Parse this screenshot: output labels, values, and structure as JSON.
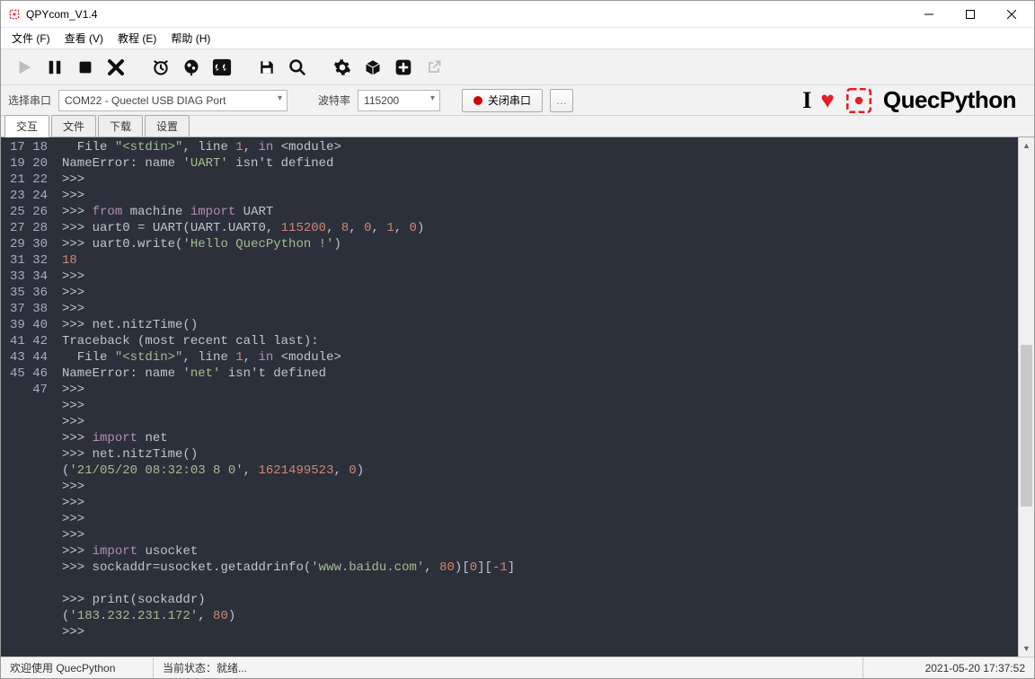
{
  "window": {
    "title": "QPYcom_V1.4"
  },
  "menu": {
    "file": "文件 (F)",
    "view": "查看 (V)",
    "tutorial": "教程 (E)",
    "help": "帮助 (H)"
  },
  "conn": {
    "port_label": "选择串口",
    "port_value": "COM22 - Quectel USB DIAG Port",
    "baud_label": "波特率",
    "baud_value": "115200",
    "close_btn": "关闭串口",
    "more_btn": "…"
  },
  "brand": {
    "i": "I",
    "name": "QuecPython"
  },
  "tabs": {
    "interact": "交互",
    "file": "文件",
    "download": "下载",
    "settings": "设置"
  },
  "editor": {
    "first_line_no": 17,
    "lines": [
      {
        "html": "  File <span class='c-str'>\"&lt;stdin&gt;\"</span>, line <span class='c-num'>1</span>, <span class='c-kw'>in</span> &lt;module&gt;"
      },
      {
        "html": "NameError: name <span class='c-str'>'UART'</span> isn't defined"
      },
      {
        "html": "<span class='c-pr'>&gt;&gt;&gt;</span>"
      },
      {
        "html": "<span class='c-pr'>&gt;&gt;&gt;</span>"
      },
      {
        "html": "<span class='c-pr'>&gt;&gt;&gt;</span> <span class='c-kw'>from</span> machine <span class='c-kw'>import</span> UART"
      },
      {
        "html": "<span class='c-pr'>&gt;&gt;&gt;</span> uart0 = UART(UART.UART0, <span class='c-num'>115200</span>, <span class='c-num'>8</span>, <span class='c-num'>0</span>, <span class='c-num'>1</span>, <span class='c-num'>0</span>)"
      },
      {
        "html": "<span class='c-pr'>&gt;&gt;&gt;</span> uart0.write(<span class='c-str'>'Hello QuecPython !'</span>)"
      },
      {
        "html": "<span class='c-num'>18</span>"
      },
      {
        "html": "<span class='c-pr'>&gt;&gt;&gt;</span>"
      },
      {
        "html": "<span class='c-pr'>&gt;&gt;&gt;</span>"
      },
      {
        "html": "<span class='c-pr'>&gt;&gt;&gt;</span>"
      },
      {
        "html": "<span class='c-pr'>&gt;&gt;&gt;</span> net.nitzTime()"
      },
      {
        "html": "Traceback (most recent call last):"
      },
      {
        "html": "  File <span class='c-str'>\"&lt;stdin&gt;\"</span>, line <span class='c-num'>1</span>, <span class='c-kw'>in</span> &lt;module&gt;"
      },
      {
        "html": "NameError: name <span class='c-str'>'net'</span> isn't defined"
      },
      {
        "html": "<span class='c-pr'>&gt;&gt;&gt;</span>"
      },
      {
        "html": "<span class='c-pr'>&gt;&gt;&gt;</span>"
      },
      {
        "html": "<span class='c-pr'>&gt;&gt;&gt;</span>"
      },
      {
        "html": "<span class='c-pr'>&gt;&gt;&gt;</span> <span class='c-kw'>import</span> net"
      },
      {
        "html": "<span class='c-pr'>&gt;&gt;&gt;</span> net.nitzTime()"
      },
      {
        "html": "(<span class='c-str'>'21/05/20 08:32:03 8 0'</span>, <span class='c-num'>1621499523</span>, <span class='c-num'>0</span>)"
      },
      {
        "html": "<span class='c-pr'>&gt;&gt;&gt;</span>"
      },
      {
        "html": "<span class='c-pr'>&gt;&gt;&gt;</span>"
      },
      {
        "html": "<span class='c-pr'>&gt;&gt;&gt;</span>"
      },
      {
        "html": "<span class='c-pr'>&gt;&gt;&gt;</span>"
      },
      {
        "html": "<span class='c-pr'>&gt;&gt;&gt;</span> <span class='c-kw'>import</span> usocket"
      },
      {
        "html": "<span class='c-pr'>&gt;&gt;&gt;</span> sockaddr=usocket.getaddrinfo(<span class='c-str'>'www.baidu.com'</span>, <span class='c-num'>80</span>)[<span class='c-num'>0</span>][<span class='c-num'>-1</span>]"
      },
      {
        "html": ""
      },
      {
        "html": "<span class='c-pr'>&gt;&gt;&gt;</span> print(sockaddr)"
      },
      {
        "html": "(<span class='c-str'>'183.232.231.172'</span>, <span class='c-num'>80</span>)"
      },
      {
        "html": "<span class='c-pr'>&gt;&gt;&gt;</span>"
      }
    ]
  },
  "status": {
    "welcome": "欢迎使用 QuecPython",
    "state": "当前状态：就绪...",
    "datetime": "2021-05-20 17:37:52"
  }
}
